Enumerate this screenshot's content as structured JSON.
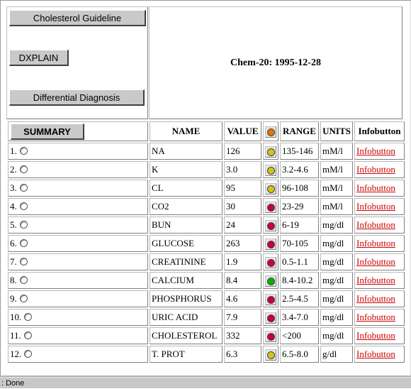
{
  "header": {
    "title": "Chem-20: 1995-12-28",
    "buttons": {
      "cholesterol": "Cholesterol Guideline",
      "dxplain": "DXPLAIN",
      "differential": "Differential Diagnosis",
      "summary": "SUMMARY"
    }
  },
  "columns": {
    "name": "NAME",
    "value": "VALUE",
    "range": "RANGE",
    "units": "UNITS",
    "info": "Infobutton"
  },
  "colors": {
    "normal_low": "#d4c21c",
    "abnormal": "#c8003c",
    "normal": "#00b400",
    "legend": "#e07800"
  },
  "rows": [
    {
      "num": "1.",
      "name": "NA",
      "value": "126",
      "status": "yellow",
      "range": "135-146",
      "units": "mM/l",
      "info": "Infobutton"
    },
    {
      "num": "2.",
      "name": "K",
      "value": "3.0",
      "status": "yellow",
      "range": "3.2-4.6",
      "units": "mM/l",
      "info": "Infobutton"
    },
    {
      "num": "3.",
      "name": "CL",
      "value": "95",
      "status": "yellow",
      "range": "96-108",
      "units": "mM/l",
      "info": "Infobutton"
    },
    {
      "num": "4.",
      "name": "CO2",
      "value": "30",
      "status": "red",
      "range": "23-29",
      "units": "mM/l",
      "info": "Infobutton"
    },
    {
      "num": "5.",
      "name": "BUN",
      "value": "24",
      "status": "red",
      "range": "6-19",
      "units": "mg/dl",
      "info": "Infobutton"
    },
    {
      "num": "6.",
      "name": "GLUCOSE",
      "value": "263",
      "status": "red",
      "range": "70-105",
      "units": "mg/dl",
      "info": "Infobutton"
    },
    {
      "num": "7.",
      "name": "CREATININE",
      "value": "1.9",
      "status": "red",
      "range": "0.5-1.1",
      "units": "mg/dl",
      "info": "Infobutton"
    },
    {
      "num": "8.",
      "name": "CALCIUM",
      "value": "8.4",
      "status": "green",
      "range": "8.4-10.2",
      "units": "mg/dl",
      "info": "Infobutton"
    },
    {
      "num": "9.",
      "name": "PHOSPHORUS",
      "value": "4.6",
      "status": "red",
      "range": "2.5-4.5",
      "units": "mg/dl",
      "info": "Infobutton"
    },
    {
      "num": "10.",
      "name": "URIC ACID",
      "value": "7.9",
      "status": "red",
      "range": "3.4-7.0",
      "units": "mg/dl",
      "info": "Infobutton"
    },
    {
      "num": "11.",
      "name": "CHOLESTEROL",
      "value": "332",
      "status": "red",
      "range": "<200",
      "units": "mg/dl",
      "info": "Infobutton"
    },
    {
      "num": "12.",
      "name": "T. PROT",
      "value": "6.3",
      "status": "yellow",
      "range": "6.5-8.0",
      "units": "g/dl",
      "info": "Infobutton"
    }
  ],
  "status_bar": {
    "text": ": Done"
  }
}
